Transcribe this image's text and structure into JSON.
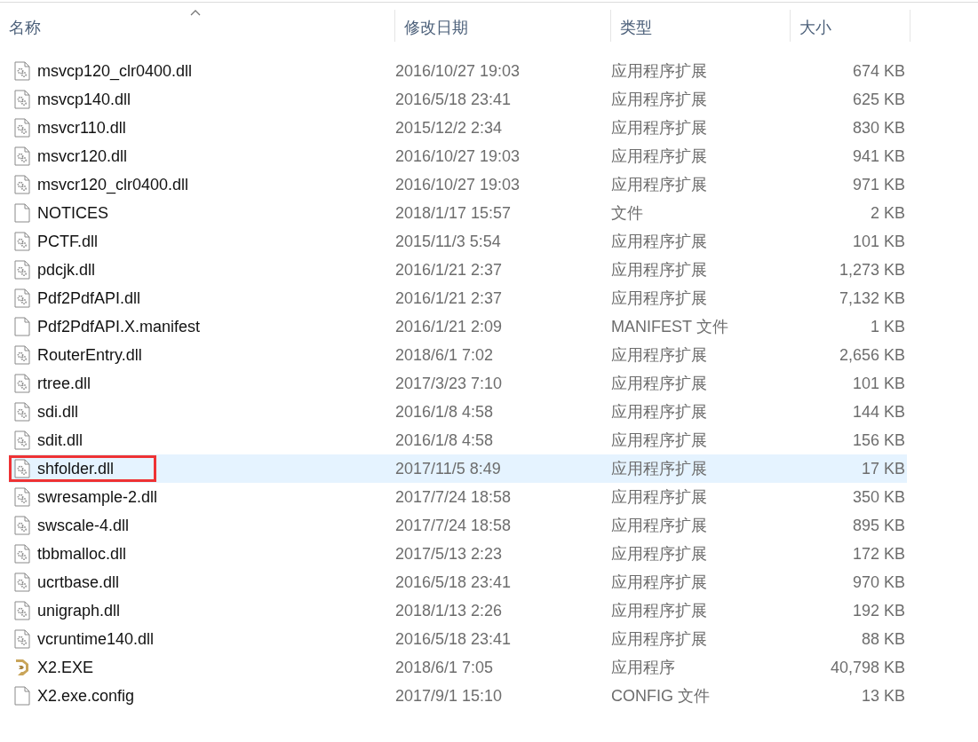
{
  "columns": [
    {
      "label": "名称",
      "sorted": true
    },
    {
      "label": "修改日期",
      "sorted": false
    },
    {
      "label": "类型",
      "sorted": false
    },
    {
      "label": "大小",
      "sorted": false
    }
  ],
  "rows": [
    {
      "kind": "dll",
      "name": "msvcp120_clr0400.dll",
      "date": "2016/10/27 19:03",
      "type": "应用程序扩展",
      "size": "674 KB",
      "selected": false,
      "annotated": false
    },
    {
      "kind": "dll",
      "name": "msvcp140.dll",
      "date": "2016/5/18 23:41",
      "type": "应用程序扩展",
      "size": "625 KB",
      "selected": false,
      "annotated": false
    },
    {
      "kind": "dll",
      "name": "msvcr110.dll",
      "date": "2015/12/2 2:34",
      "type": "应用程序扩展",
      "size": "830 KB",
      "selected": false,
      "annotated": false
    },
    {
      "kind": "dll",
      "name": "msvcr120.dll",
      "date": "2016/10/27 19:03",
      "type": "应用程序扩展",
      "size": "941 KB",
      "selected": false,
      "annotated": false
    },
    {
      "kind": "dll",
      "name": "msvcr120_clr0400.dll",
      "date": "2016/10/27 19:03",
      "type": "应用程序扩展",
      "size": "971 KB",
      "selected": false,
      "annotated": false
    },
    {
      "kind": "file",
      "name": "NOTICES",
      "date": "2018/1/17 15:57",
      "type": "文件",
      "size": "2 KB",
      "selected": false,
      "annotated": false
    },
    {
      "kind": "dll",
      "name": "PCTF.dll",
      "date": "2015/11/3 5:54",
      "type": "应用程序扩展",
      "size": "101 KB",
      "selected": false,
      "annotated": false
    },
    {
      "kind": "dll",
      "name": "pdcjk.dll",
      "date": "2016/1/21 2:37",
      "type": "应用程序扩展",
      "size": "1,273 KB",
      "selected": false,
      "annotated": false
    },
    {
      "kind": "dll",
      "name": "Pdf2PdfAPI.dll",
      "date": "2016/1/21 2:37",
      "type": "应用程序扩展",
      "size": "7,132 KB",
      "selected": false,
      "annotated": false
    },
    {
      "kind": "file",
      "name": "Pdf2PdfAPI.X.manifest",
      "date": "2016/1/21 2:09",
      "type": "MANIFEST 文件",
      "size": "1 KB",
      "selected": false,
      "annotated": false
    },
    {
      "kind": "dll",
      "name": "RouterEntry.dll",
      "date": "2018/6/1 7:02",
      "type": "应用程序扩展",
      "size": "2,656 KB",
      "selected": false,
      "annotated": false
    },
    {
      "kind": "dll",
      "name": "rtree.dll",
      "date": "2017/3/23 7:10",
      "type": "应用程序扩展",
      "size": "101 KB",
      "selected": false,
      "annotated": false
    },
    {
      "kind": "dll",
      "name": "sdi.dll",
      "date": "2016/1/8 4:58",
      "type": "应用程序扩展",
      "size": "144 KB",
      "selected": false,
      "annotated": false
    },
    {
      "kind": "dll",
      "name": "sdit.dll",
      "date": "2016/1/8 4:58",
      "type": "应用程序扩展",
      "size": "156 KB",
      "selected": false,
      "annotated": false
    },
    {
      "kind": "dll",
      "name": "shfolder.dll",
      "date": "2017/11/5 8:49",
      "type": "应用程序扩展",
      "size": "17 KB",
      "selected": true,
      "annotated": true
    },
    {
      "kind": "dll",
      "name": "swresample-2.dll",
      "date": "2017/7/24 18:58",
      "type": "应用程序扩展",
      "size": "350 KB",
      "selected": false,
      "annotated": false
    },
    {
      "kind": "dll",
      "name": "swscale-4.dll",
      "date": "2017/7/24 18:58",
      "type": "应用程序扩展",
      "size": "895 KB",
      "selected": false,
      "annotated": false
    },
    {
      "kind": "dll",
      "name": "tbbmalloc.dll",
      "date": "2017/5/13 2:23",
      "type": "应用程序扩展",
      "size": "172 KB",
      "selected": false,
      "annotated": false
    },
    {
      "kind": "dll",
      "name": "ucrtbase.dll",
      "date": "2016/5/18 23:41",
      "type": "应用程序扩展",
      "size": "970 KB",
      "selected": false,
      "annotated": false
    },
    {
      "kind": "dll",
      "name": "unigraph.dll",
      "date": "2018/1/13 2:26",
      "type": "应用程序扩展",
      "size": "192 KB",
      "selected": false,
      "annotated": false
    },
    {
      "kind": "dll",
      "name": "vcruntime140.dll",
      "date": "2016/5/18 23:41",
      "type": "应用程序扩展",
      "size": "88 KB",
      "selected": false,
      "annotated": false
    },
    {
      "kind": "exe",
      "name": "X2.EXE",
      "date": "2018/6/1 7:05",
      "type": "应用程序",
      "size": "40,798 KB",
      "selected": false,
      "annotated": false
    },
    {
      "kind": "file",
      "name": "X2.exe.config",
      "date": "2017/9/1 15:10",
      "type": "CONFIG 文件",
      "size": "13 KB",
      "selected": false,
      "annotated": false
    }
  ]
}
